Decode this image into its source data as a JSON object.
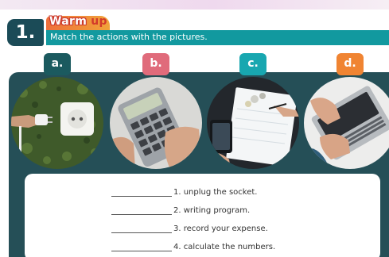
{
  "exercise": {
    "number": "1.",
    "title_word_1": "Warm",
    "title_word_2": "up",
    "instruction": "Match the actions with the pictures."
  },
  "pictures": [
    {
      "letter": "a.",
      "depicts": "plug-and-socket-image",
      "tab_color": "#1b5a5f"
    },
    {
      "letter": "b.",
      "depicts": "calculator-image",
      "tab_color": "#e06b7b"
    },
    {
      "letter": "c.",
      "depicts": "expense-notebook-image",
      "tab_color": "#18a7b0"
    },
    {
      "letter": "d.",
      "depicts": "laptop-typing-image",
      "tab_color": "#f08432"
    }
  ],
  "actions": [
    {
      "text": "1. unplug the socket."
    },
    {
      "text": "2. writing program."
    },
    {
      "text": "3. record your expense."
    },
    {
      "text": "4. calculate the numbers."
    }
  ],
  "colors": {
    "panel": "#254f57",
    "header_bar": "#12999f",
    "number_block": "#1b4b57",
    "title_tab": "#ef6f3b"
  }
}
